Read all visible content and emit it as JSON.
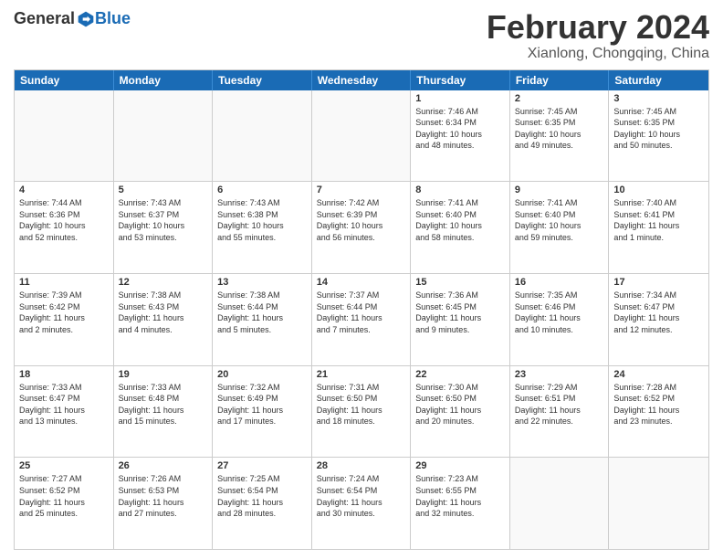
{
  "logo": {
    "general": "General",
    "blue": "Blue"
  },
  "title": {
    "month": "February 2024",
    "location": "Xianlong, Chongqing, China"
  },
  "header": {
    "days": [
      "Sunday",
      "Monday",
      "Tuesday",
      "Wednesday",
      "Thursday",
      "Friday",
      "Saturday"
    ]
  },
  "weeks": [
    [
      {
        "day": "",
        "empty": true,
        "lines": []
      },
      {
        "day": "",
        "empty": true,
        "lines": []
      },
      {
        "day": "",
        "empty": true,
        "lines": []
      },
      {
        "day": "",
        "empty": true,
        "lines": []
      },
      {
        "day": "1",
        "empty": false,
        "lines": [
          "Sunrise: 7:46 AM",
          "Sunset: 6:34 PM",
          "Daylight: 10 hours",
          "and 48 minutes."
        ]
      },
      {
        "day": "2",
        "empty": false,
        "lines": [
          "Sunrise: 7:45 AM",
          "Sunset: 6:35 PM",
          "Daylight: 10 hours",
          "and 49 minutes."
        ]
      },
      {
        "day": "3",
        "empty": false,
        "lines": [
          "Sunrise: 7:45 AM",
          "Sunset: 6:35 PM",
          "Daylight: 10 hours",
          "and 50 minutes."
        ]
      }
    ],
    [
      {
        "day": "4",
        "empty": false,
        "lines": [
          "Sunrise: 7:44 AM",
          "Sunset: 6:36 PM",
          "Daylight: 10 hours",
          "and 52 minutes."
        ]
      },
      {
        "day": "5",
        "empty": false,
        "lines": [
          "Sunrise: 7:43 AM",
          "Sunset: 6:37 PM",
          "Daylight: 10 hours",
          "and 53 minutes."
        ]
      },
      {
        "day": "6",
        "empty": false,
        "lines": [
          "Sunrise: 7:43 AM",
          "Sunset: 6:38 PM",
          "Daylight: 10 hours",
          "and 55 minutes."
        ]
      },
      {
        "day": "7",
        "empty": false,
        "lines": [
          "Sunrise: 7:42 AM",
          "Sunset: 6:39 PM",
          "Daylight: 10 hours",
          "and 56 minutes."
        ]
      },
      {
        "day": "8",
        "empty": false,
        "lines": [
          "Sunrise: 7:41 AM",
          "Sunset: 6:40 PM",
          "Daylight: 10 hours",
          "and 58 minutes."
        ]
      },
      {
        "day": "9",
        "empty": false,
        "lines": [
          "Sunrise: 7:41 AM",
          "Sunset: 6:40 PM",
          "Daylight: 10 hours",
          "and 59 minutes."
        ]
      },
      {
        "day": "10",
        "empty": false,
        "lines": [
          "Sunrise: 7:40 AM",
          "Sunset: 6:41 PM",
          "Daylight: 11 hours",
          "and 1 minute."
        ]
      }
    ],
    [
      {
        "day": "11",
        "empty": false,
        "lines": [
          "Sunrise: 7:39 AM",
          "Sunset: 6:42 PM",
          "Daylight: 11 hours",
          "and 2 minutes."
        ]
      },
      {
        "day": "12",
        "empty": false,
        "lines": [
          "Sunrise: 7:38 AM",
          "Sunset: 6:43 PM",
          "Daylight: 11 hours",
          "and 4 minutes."
        ]
      },
      {
        "day": "13",
        "empty": false,
        "lines": [
          "Sunrise: 7:38 AM",
          "Sunset: 6:44 PM",
          "Daylight: 11 hours",
          "and 5 minutes."
        ]
      },
      {
        "day": "14",
        "empty": false,
        "lines": [
          "Sunrise: 7:37 AM",
          "Sunset: 6:44 PM",
          "Daylight: 11 hours",
          "and 7 minutes."
        ]
      },
      {
        "day": "15",
        "empty": false,
        "lines": [
          "Sunrise: 7:36 AM",
          "Sunset: 6:45 PM",
          "Daylight: 11 hours",
          "and 9 minutes."
        ]
      },
      {
        "day": "16",
        "empty": false,
        "lines": [
          "Sunrise: 7:35 AM",
          "Sunset: 6:46 PM",
          "Daylight: 11 hours",
          "and 10 minutes."
        ]
      },
      {
        "day": "17",
        "empty": false,
        "lines": [
          "Sunrise: 7:34 AM",
          "Sunset: 6:47 PM",
          "Daylight: 11 hours",
          "and 12 minutes."
        ]
      }
    ],
    [
      {
        "day": "18",
        "empty": false,
        "lines": [
          "Sunrise: 7:33 AM",
          "Sunset: 6:47 PM",
          "Daylight: 11 hours",
          "and 13 minutes."
        ]
      },
      {
        "day": "19",
        "empty": false,
        "lines": [
          "Sunrise: 7:33 AM",
          "Sunset: 6:48 PM",
          "Daylight: 11 hours",
          "and 15 minutes."
        ]
      },
      {
        "day": "20",
        "empty": false,
        "lines": [
          "Sunrise: 7:32 AM",
          "Sunset: 6:49 PM",
          "Daylight: 11 hours",
          "and 17 minutes."
        ]
      },
      {
        "day": "21",
        "empty": false,
        "lines": [
          "Sunrise: 7:31 AM",
          "Sunset: 6:50 PM",
          "Daylight: 11 hours",
          "and 18 minutes."
        ]
      },
      {
        "day": "22",
        "empty": false,
        "lines": [
          "Sunrise: 7:30 AM",
          "Sunset: 6:50 PM",
          "Daylight: 11 hours",
          "and 20 minutes."
        ]
      },
      {
        "day": "23",
        "empty": false,
        "lines": [
          "Sunrise: 7:29 AM",
          "Sunset: 6:51 PM",
          "Daylight: 11 hours",
          "and 22 minutes."
        ]
      },
      {
        "day": "24",
        "empty": false,
        "lines": [
          "Sunrise: 7:28 AM",
          "Sunset: 6:52 PM",
          "Daylight: 11 hours",
          "and 23 minutes."
        ]
      }
    ],
    [
      {
        "day": "25",
        "empty": false,
        "lines": [
          "Sunrise: 7:27 AM",
          "Sunset: 6:52 PM",
          "Daylight: 11 hours",
          "and 25 minutes."
        ]
      },
      {
        "day": "26",
        "empty": false,
        "lines": [
          "Sunrise: 7:26 AM",
          "Sunset: 6:53 PM",
          "Daylight: 11 hours",
          "and 27 minutes."
        ]
      },
      {
        "day": "27",
        "empty": false,
        "lines": [
          "Sunrise: 7:25 AM",
          "Sunset: 6:54 PM",
          "Daylight: 11 hours",
          "and 28 minutes."
        ]
      },
      {
        "day": "28",
        "empty": false,
        "lines": [
          "Sunrise: 7:24 AM",
          "Sunset: 6:54 PM",
          "Daylight: 11 hours",
          "and 30 minutes."
        ]
      },
      {
        "day": "29",
        "empty": false,
        "lines": [
          "Sunrise: 7:23 AM",
          "Sunset: 6:55 PM",
          "Daylight: 11 hours",
          "and 32 minutes."
        ]
      },
      {
        "day": "",
        "empty": true,
        "lines": []
      },
      {
        "day": "",
        "empty": true,
        "lines": []
      }
    ]
  ]
}
